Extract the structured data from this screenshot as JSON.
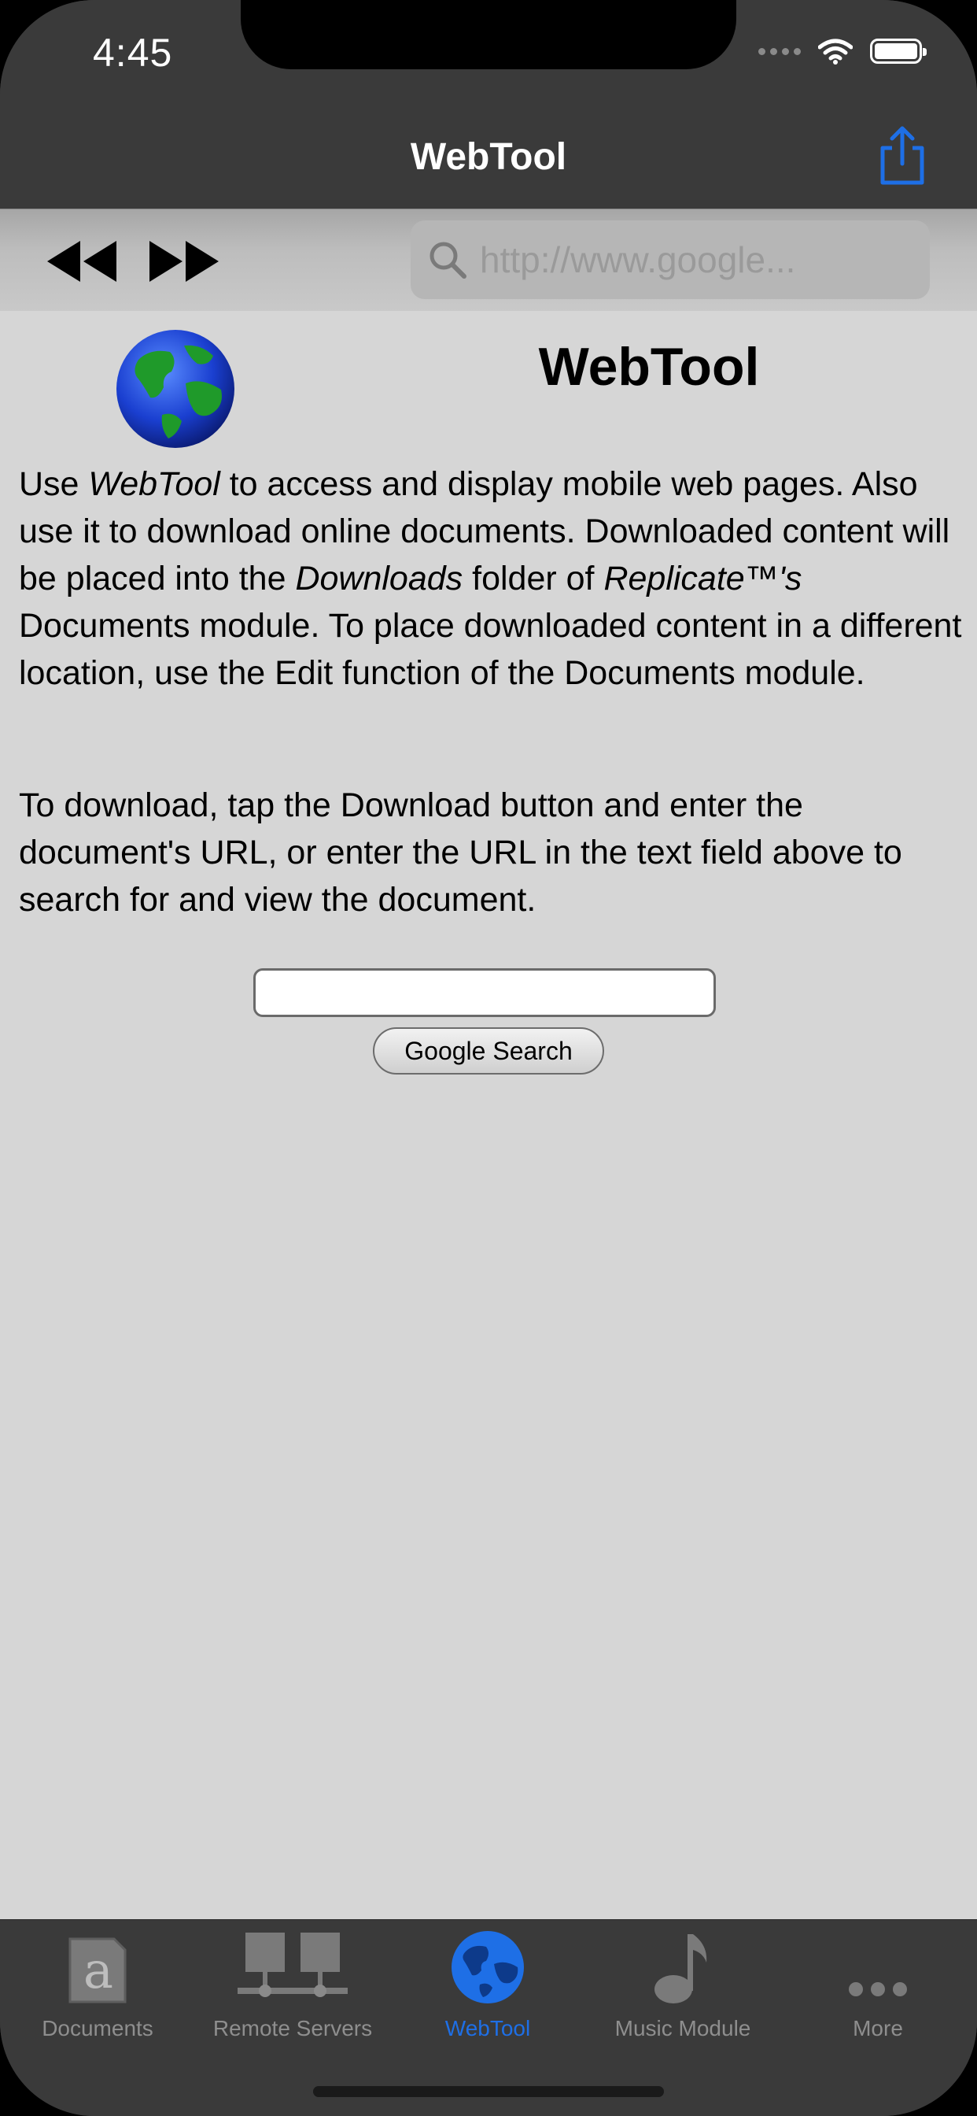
{
  "status_bar": {
    "time": "4:45"
  },
  "nav": {
    "title": "WebTool"
  },
  "toolbar": {
    "url_placeholder": "http://www.google..."
  },
  "content": {
    "heading": "WebTool",
    "p1": {
      "seg1": "Use ",
      "seg2_italic": "WebTool",
      "seg3": " to access and display mobile web pages. Also use it to download online documents. Downloaded content will be placed into the ",
      "seg4_italic": "Downloads",
      "seg5": " folder of ",
      "seg6_italic": "Replicate™'s",
      "seg7": " Documents module. To place downloaded content in a different location, use the Edit function of the Documents module."
    },
    "p2": "To download, tap the Download button and enter the document's URL, or enter the URL in the text field above to search for and view the document.",
    "search_value": "",
    "search_button": "Google Search"
  },
  "tabs": [
    {
      "label": "Documents",
      "icon": "documents-icon",
      "active": false
    },
    {
      "label": "Remote Servers",
      "icon": "servers-icon",
      "active": false
    },
    {
      "label": "WebTool",
      "icon": "globe-icon",
      "active": true
    },
    {
      "label": "Music Module",
      "icon": "music-note-icon",
      "active": false
    },
    {
      "label": "More",
      "icon": "more-icon",
      "active": false
    }
  ],
  "colors": {
    "accent": "#1e6fe6",
    "nav_bg": "#3a3a3a",
    "content_bg": "#d6d6d6"
  }
}
